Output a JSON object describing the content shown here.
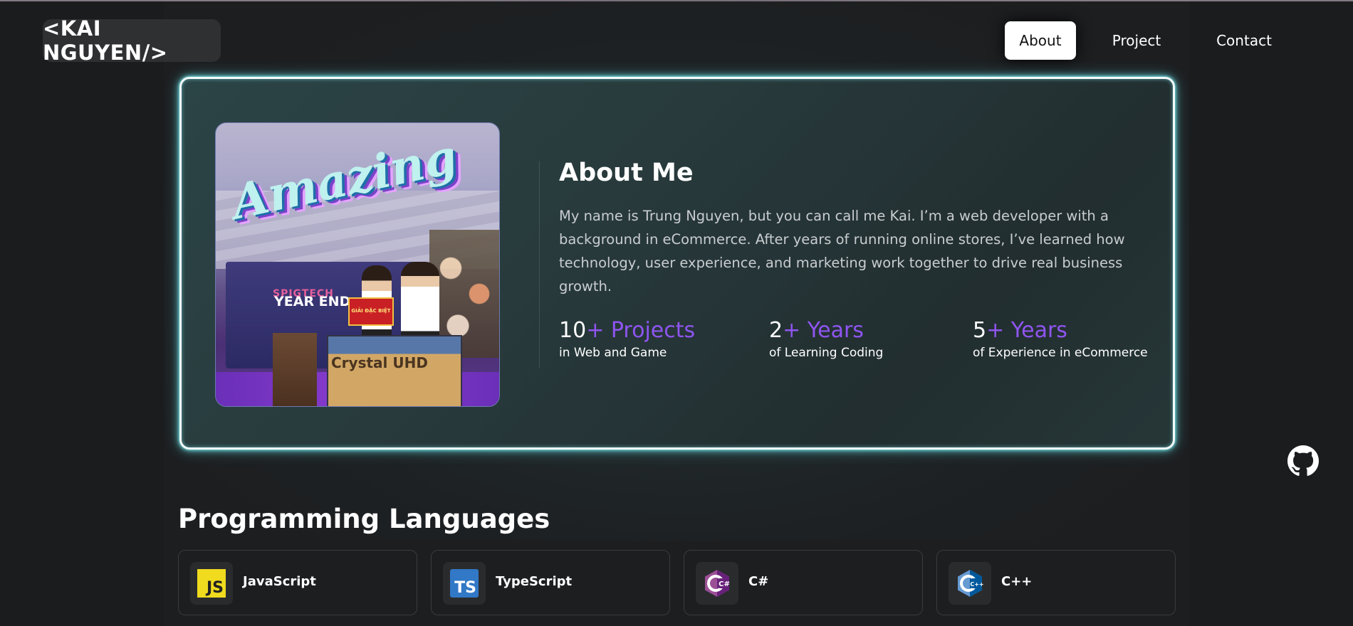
{
  "header": {
    "logo": "<KAI NGUYEN/>",
    "nav": [
      {
        "label": "About",
        "active": true
      },
      {
        "label": "Project",
        "active": false
      },
      {
        "label": "Contact",
        "active": false
      }
    ]
  },
  "about": {
    "title": "About Me",
    "bio": "My name is Trung Nguyen, but you can call me Kai. I’m a web developer with a background in eCommerce. After years of running online stores, I’ve learned how technology, user experience, and marketing work together to drive real business growth.",
    "photo": {
      "overlay_text": "Amazing",
      "banner_brand": "SPIGTECH",
      "banner_text": "YEAR END",
      "prize_text": "GIẢI ĐẶC BIỆT",
      "box_text": "Crystal UHD"
    },
    "stats": [
      {
        "number": "10",
        "suffix": "+ Projects",
        "caption": "in Web and Game"
      },
      {
        "number": "2",
        "suffix": "+ Years",
        "caption": "of Learning Coding"
      },
      {
        "number": "5",
        "suffix": "+ Years",
        "caption": "of Experience in eCommerce"
      }
    ]
  },
  "languages": {
    "title": "Programming Languages",
    "items": [
      {
        "name": "JavaScript",
        "icon": "javascript-icon",
        "badge": "JS"
      },
      {
        "name": "TypeScript",
        "icon": "typescript-icon",
        "badge": "TS"
      },
      {
        "name": "C#",
        "icon": "csharp-icon",
        "badge": "C#"
      },
      {
        "name": "C++",
        "icon": "cplusplus-icon",
        "badge": "C++"
      }
    ]
  },
  "social": {
    "github_icon": "github-icon"
  },
  "colors": {
    "accent": "#8f55f0",
    "glow": "#7ff2f5",
    "background": "#1b1c1e"
  }
}
